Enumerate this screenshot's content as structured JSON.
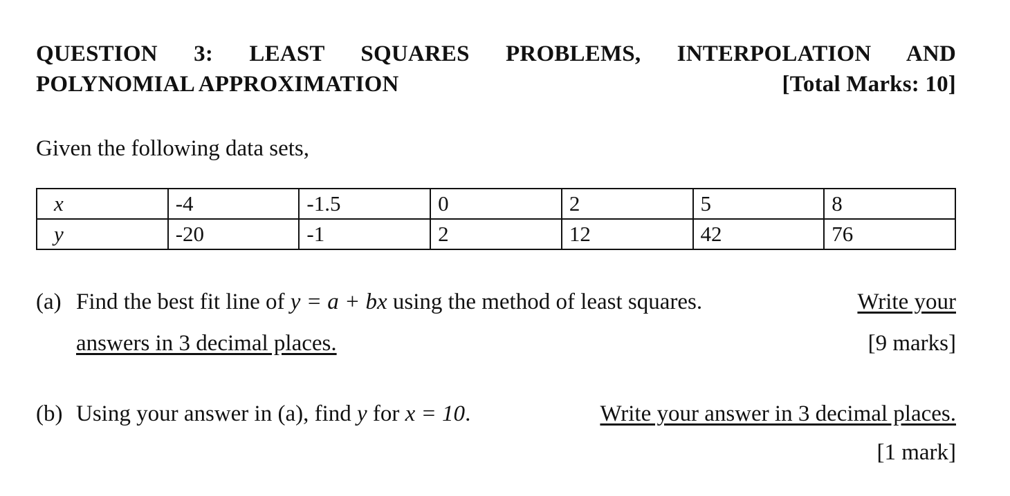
{
  "question": {
    "title_line1": "QUESTION 3:   LEAST SQUARES PROBLEMS, INTERPOLATION AND",
    "title_line2": "POLYNOMIAL APPROXIMATION",
    "total_marks": "[Total Marks: 10]"
  },
  "intro": "Given the following data sets,",
  "table": {
    "rows": [
      {
        "var": "x",
        "values": [
          "-4",
          "-1.5",
          "0",
          "2",
          "5",
          "8"
        ]
      },
      {
        "var": "y",
        "values": [
          "-20",
          "-1",
          "2",
          "12",
          "42",
          "76"
        ]
      }
    ]
  },
  "part_a": {
    "label": "(a)",
    "text_before": "Find the best fit line of",
    "equation": "y = a + bx",
    "text_after": "using the method of least squares.",
    "instruction_part1": "Write your",
    "instruction_part2": "answers in 3 decimal places.",
    "marks": "[9 marks]"
  },
  "part_b": {
    "label": "(b)",
    "text_before": "Using your answer in (a), find",
    "var": "y",
    "text_mid": "for",
    "equation": "x = 10",
    "text_after": ".",
    "instruction": "Write your answer in 3 decimal places.",
    "marks": "[1 mark]"
  }
}
